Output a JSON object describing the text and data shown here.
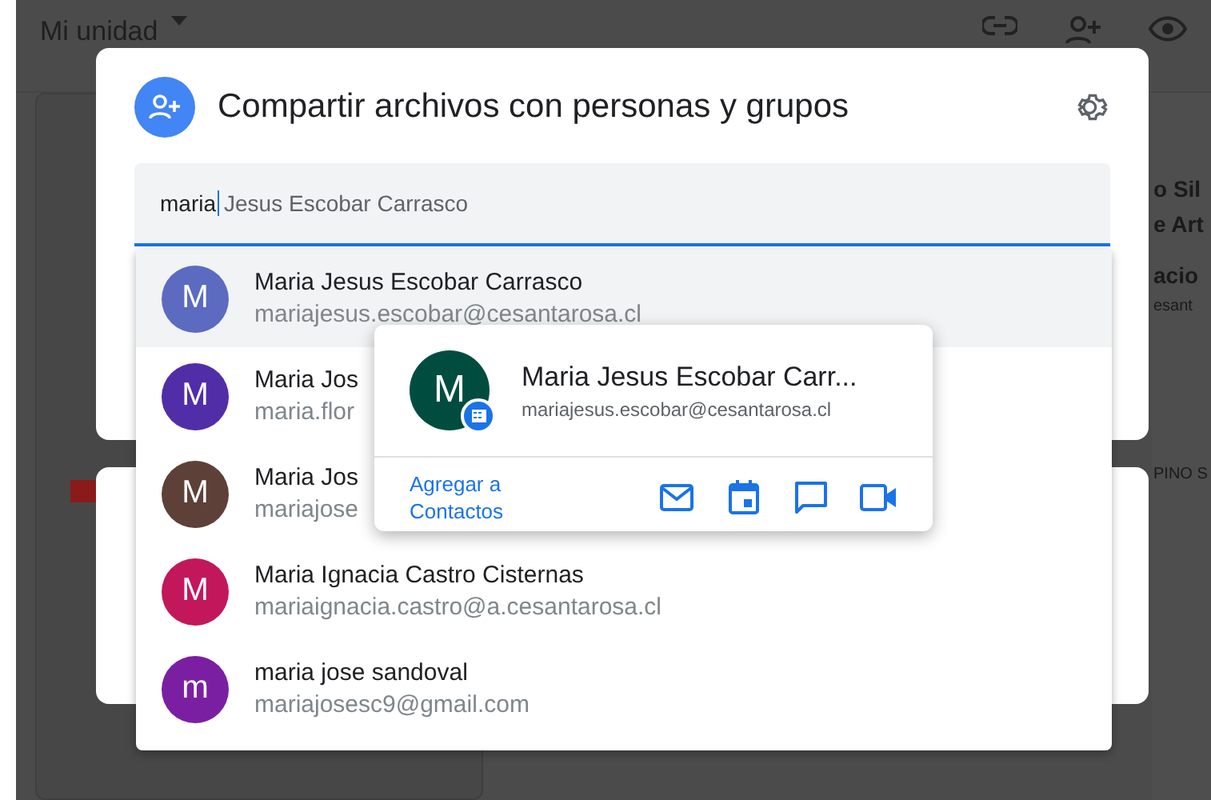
{
  "background": {
    "title": "Mi unidad",
    "card_fragments": [
      "o Sil",
      "e Art",
      "acio",
      "esant"
    ],
    "label_fragment": "PINO S"
  },
  "dialog": {
    "title": "Compartir archivos con personas y grupos",
    "search": {
      "value": "maria",
      "suggestion": "Jesus Escobar Carrasco"
    }
  },
  "suggestions": [
    {
      "initial": "M",
      "name": "Maria Jesus Escobar Carrasco",
      "email": "mariajesus.escobar@cesantarosa.cl",
      "color": "#5c6bc0",
      "selected": true
    },
    {
      "initial": "M",
      "name": "Maria Jos",
      "email": "maria.flor",
      "color": "#512da8",
      "selected": false
    },
    {
      "initial": "M",
      "name": "Maria Jos",
      "email": "mariajose",
      "color": "#5d4037",
      "selected": false
    },
    {
      "initial": "M",
      "name": "Maria Ignacia Castro Cisternas",
      "email": "mariaignacia.castro@a.cesantarosa.cl",
      "color": "#c2185b",
      "selected": false
    },
    {
      "initial": "m",
      "name": "maria jose sandoval",
      "email": "mariajosesc9@gmail.com",
      "color": "#7b1fa2",
      "selected": false
    }
  ],
  "contact_card": {
    "initial": "M",
    "name": "Maria Jesus Escobar Carr...",
    "email": "mariajesus.escobar@cesantarosa.cl",
    "add_link": "Agregar a Contactos",
    "actions": [
      {
        "kind": "mail"
      },
      {
        "kind": "calendar"
      },
      {
        "kind": "chat"
      },
      {
        "kind": "video"
      }
    ]
  }
}
